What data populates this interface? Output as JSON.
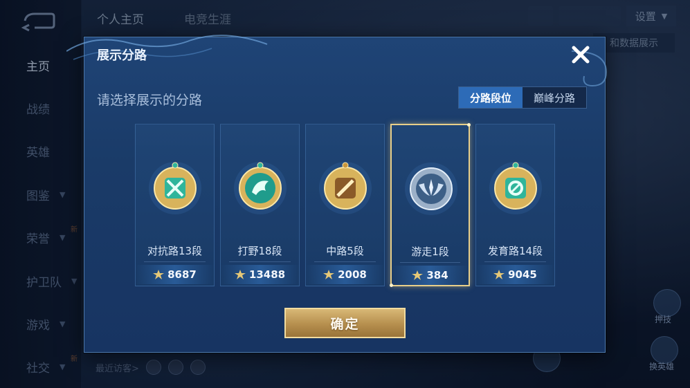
{
  "sidebar": {
    "items": [
      {
        "label": "主页",
        "active": true
      },
      {
        "label": "战绩"
      },
      {
        "label": "英雄"
      },
      {
        "label": "图鉴",
        "chevron": true
      },
      {
        "label": "荣誉",
        "chevron": true,
        "badge": "新"
      },
      {
        "label": "护卫队",
        "chevron": true
      },
      {
        "label": "游戏",
        "chevron": true
      },
      {
        "label": "社交",
        "chevron": true,
        "badge": "新"
      }
    ]
  },
  "header": {
    "tabs": [
      "个人主页",
      "电竞生涯"
    ],
    "settings_label": "设置",
    "data_display_label": "和数据展示"
  },
  "footer": {
    "visitors_label": "最近访客>"
  },
  "background_buttons": {
    "top_label": "押技",
    "bottom_label": "换英雄"
  },
  "modal": {
    "title": "展示分路",
    "subtitle": "请选择展示的分路",
    "segments": [
      {
        "label": "分路段位",
        "active": true
      },
      {
        "label": "巅峰分路",
        "active": false
      }
    ],
    "cards": [
      {
        "name": "对抗路13段",
        "score": "8687",
        "emblem": "crossed-swords-gold-icon",
        "selected": false
      },
      {
        "name": "打野18段",
        "score": "13488",
        "emblem": "dragon-gold-icon",
        "selected": false
      },
      {
        "name": "中路5段",
        "score": "2008",
        "emblem": "staff-gold-icon",
        "selected": false
      },
      {
        "name": "游走1段",
        "score": "384",
        "emblem": "wings-silver-icon",
        "selected": true
      },
      {
        "name": "发育路14段",
        "score": "9045",
        "emblem": "ring-gold-icon",
        "selected": false
      }
    ],
    "confirm_label": "确定"
  },
  "colors": {
    "modal_bg": "#1f4476",
    "accent_blue": "#2d6bb7",
    "gold": "#d8b876",
    "selected_border": "#e8cf8a"
  }
}
